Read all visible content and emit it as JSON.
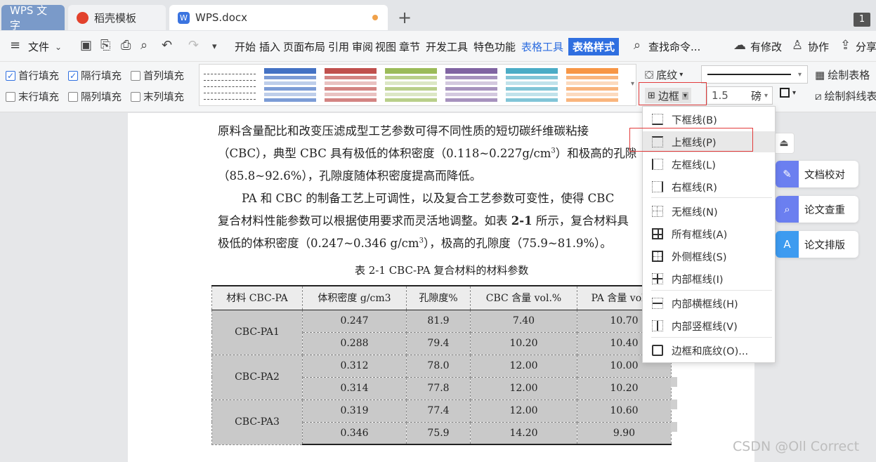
{
  "tabs": {
    "wps": "WPS 文字",
    "daoke": "稻壳模板",
    "doc": "WPS.docx",
    "page_count": "1"
  },
  "menu": {
    "file": "文件",
    "items": [
      "开始",
      "插入",
      "页面布局",
      "引用",
      "审阅",
      "视图",
      "章节",
      "开发工具",
      "特色功能"
    ],
    "table_tools": "表格工具",
    "table_style": "表格样式",
    "search": "查找命令...",
    "modify": "有修改",
    "collab": "协作",
    "share": "分享"
  },
  "ribbon": {
    "checks": [
      {
        "label": "首行填充",
        "checked": true
      },
      {
        "label": "隔行填充",
        "checked": true
      },
      {
        "label": "首列填充",
        "checked": false
      },
      {
        "label": "末行填充",
        "checked": false
      },
      {
        "label": "隔列填充",
        "checked": false
      },
      {
        "label": "末列填充",
        "checked": false
      }
    ],
    "style_colors": [
      "#4472c4",
      "#c0504d",
      "#9bbb59",
      "#8064a2",
      "#4bacc6",
      "#f79646"
    ],
    "shading": "底纹",
    "border": "边框",
    "line_width": "1.5",
    "line_unit": "磅",
    "draw_table": "绘制表格",
    "draw_diagonal": "绘制斜线表"
  },
  "document": {
    "lines": [
      "原料含量配比和改变压滤成型工艺参数可得不同性质的短切碳纤维碳粘接",
      "（CBC），典型 CBC 具有极低的体积密度（0.118~0.227g/cm",
      "和极高的孔隙",
      "（85.8~92.6%），孔隙度随体积密度提高而降低。",
      "PA 和 CBC 的制备工艺上可调性，以及复合工艺参数可变性，使得 CBC",
      "复合材料性能参数可以根据使用要求而灵活地调整。如表",
      "2-1",
      "所示，复合材料具",
      "极低的体积密度（0.247~0.346 g/cm",
      "），极高的孔隙度（75.9~81.9%）。"
    ],
    "sup3": "3",
    "caption": "表 2-1 CBC-PA 复合材料的材料参数",
    "table": {
      "headers": [
        "材料 CBC-PA",
        "体积密度 g/cm3",
        "孔隙度%",
        "CBC 含量 vol.%",
        "PA 含量 vol.%"
      ],
      "groups": [
        {
          "name": "CBC-PA1",
          "rows": [
            [
              "0.247",
              "81.9",
              "7.40",
              "10.70"
            ],
            [
              "0.288",
              "79.4",
              "10.20",
              "10.40"
            ]
          ]
        },
        {
          "name": "CBC-PA2",
          "rows": [
            [
              "0.312",
              "78.0",
              "12.00",
              "10.00"
            ],
            [
              "0.314",
              "77.8",
              "12.00",
              "10.20"
            ]
          ]
        },
        {
          "name": "CBC-PA3",
          "rows": [
            [
              "0.319",
              "77.4",
              "12.00",
              "10.60"
            ],
            [
              "0.346",
              "75.9",
              "14.20",
              "9.90"
            ]
          ]
        }
      ]
    }
  },
  "border_menu": [
    {
      "label": "下框线(B)",
      "icon": "border-bottom-icon"
    },
    {
      "label": "上框线(P)",
      "icon": "border-top-icon"
    },
    {
      "label": "左框线(L)",
      "icon": "border-left-icon"
    },
    {
      "label": "右框线(R)",
      "icon": "border-right-icon"
    },
    {
      "label": "无框线(N)",
      "icon": "border-none-icon"
    },
    {
      "label": "所有框线(A)",
      "icon": "border-all-icon"
    },
    {
      "label": "外侧框线(S)",
      "icon": "border-outside-icon"
    },
    {
      "label": "内部框线(I)",
      "icon": "border-inside-icon"
    },
    {
      "label": "内部横框线(H)",
      "icon": "border-inside-horizontal-icon"
    },
    {
      "label": "内部竖框线(V)",
      "icon": "border-inside-vertical-icon"
    },
    {
      "label": "边框和底纹(O)...",
      "icon": "borders-and-shading-icon"
    }
  ],
  "side_panel": [
    "文档校对",
    "论文查重",
    "论文排版"
  ],
  "watermark": "CSDN @Oll Correct"
}
